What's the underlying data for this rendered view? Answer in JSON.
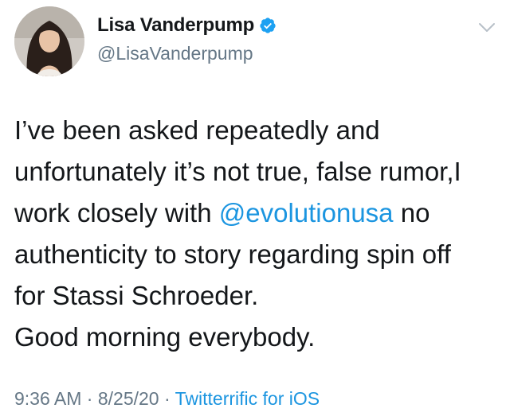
{
  "author": {
    "display_name": "Lisa Vanderpump",
    "handle": "@LisaVanderpump",
    "verified": true,
    "avatar_icon": "profile-photo-avatar"
  },
  "menu_icon": "chevron-down-icon",
  "tweet": {
    "line1": "I’ve been asked repeatedly  and",
    "line2": "unfortunately it’s not true, false rumor,I",
    "line3_before": "work closely with ",
    "line3_mention": "@evolutionusa",
    "line3_after": " no",
    "line4": "authenticity to story regarding spin off",
    "line5": "for Stassi Schroeder.",
    "line6": "Good morning everybody."
  },
  "meta": {
    "time": "9:36 AM",
    "separator1": " · ",
    "date": "8/25/20",
    "separator2": " · ",
    "source": "Twitterrific for iOS"
  },
  "colors": {
    "link": "#1b95e0",
    "secondary_text": "#657786",
    "primary_text": "#14171a",
    "verified_badge": "#1da1f2"
  }
}
